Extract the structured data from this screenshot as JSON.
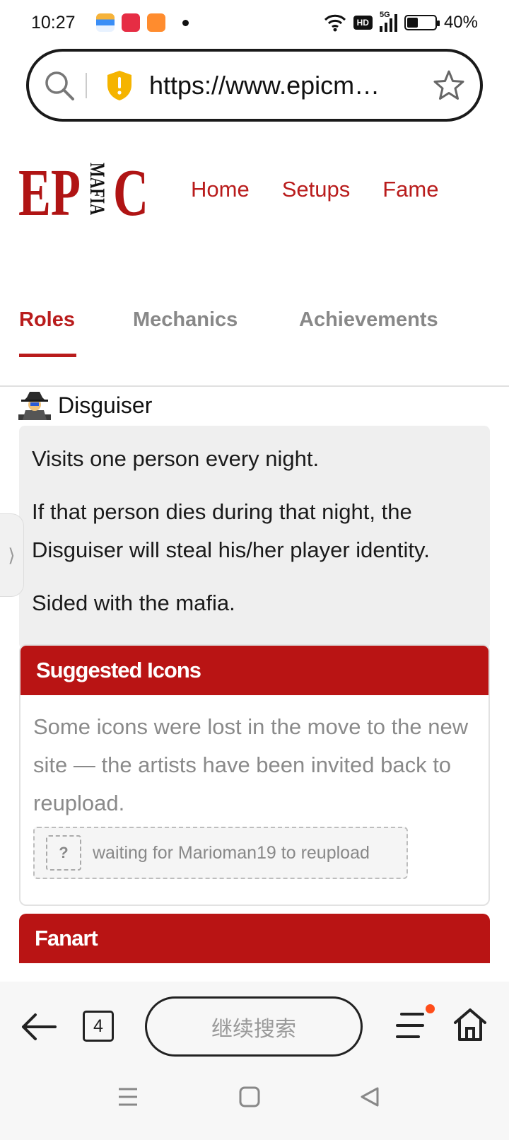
{
  "status_bar": {
    "time": "10:27",
    "network": "5G",
    "hd_label": "HD",
    "battery": "40%"
  },
  "browser": {
    "url": "https://www.epicm…"
  },
  "site": {
    "logo_text_main": "EPIC",
    "logo_text_sub": "MAFIA",
    "nav": [
      "Home",
      "Setups",
      "Fame"
    ]
  },
  "tabs": [
    {
      "label": "Roles",
      "active": true
    },
    {
      "label": "Mechanics",
      "active": false
    },
    {
      "label": "Achievements",
      "active": false
    }
  ],
  "role": {
    "name": "Disguiser",
    "descriptions": [
      "Visits one person every night.",
      "If that person dies during that night, the Disguiser will steal his/her player identity.",
      "Sided with the mafia."
    ]
  },
  "suggested_icons": {
    "title": "Suggested Icons",
    "note": "Some icons were lost in the move to the new site — the artists have been invited back to reupload.",
    "placeholder_mark": "?",
    "placeholder_text": "waiting for Marioman19 to reupload"
  },
  "fanart": {
    "title": "Fanart"
  },
  "toolbar": {
    "tab_count": "4",
    "search_label": "继续搜索"
  },
  "colors": {
    "brand_red": "#b91414",
    "notification": "#ff4d1a"
  }
}
